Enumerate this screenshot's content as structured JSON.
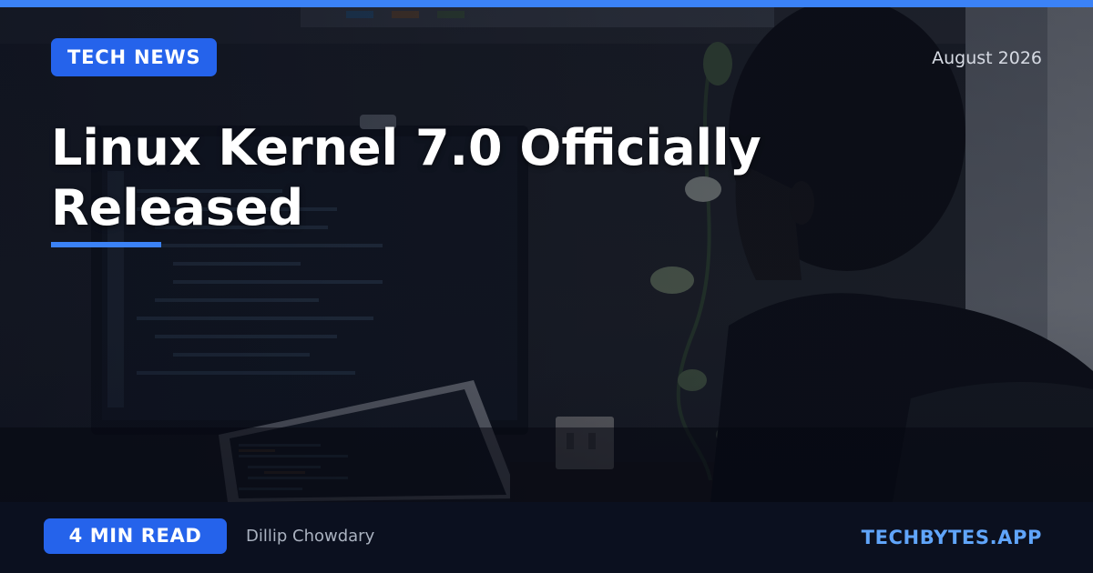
{
  "header": {
    "category": "TECH NEWS",
    "date": "August 2026"
  },
  "article": {
    "title": "Linux Kernel 7.0 Officially Released"
  },
  "footer": {
    "read_time": "4 MIN READ",
    "author": "Dillip Chowdary",
    "site": "TECHBYTES.APP"
  },
  "colors": {
    "accent": "#3b82f6",
    "badge": "#2563eb",
    "site_link": "#60a5fa",
    "footer_bg": "#0b101f"
  },
  "background_image": "photo of a person working at a desk with a monitor and laptop showing code"
}
